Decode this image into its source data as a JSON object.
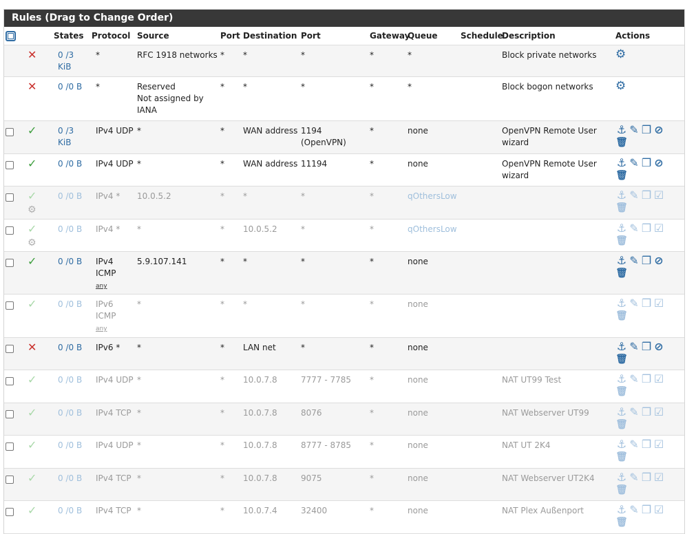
{
  "panel_title": "Rules (Drag to Change Order)",
  "columns": [
    "",
    "",
    "States",
    "Protocol",
    "Source",
    "Port",
    "Destination",
    "Port",
    "Gateway",
    "Queue",
    "Schedule",
    "Description",
    "Actions"
  ],
  "rows": [
    {
      "cb": false,
      "status": "block",
      "states": "0 /3 KiB",
      "protocol": "*",
      "protocol_sub": "",
      "source": "RFC 1918 networks",
      "sport": "*",
      "dest": "*",
      "dport": "*",
      "gateway": "*",
      "queue": "*",
      "schedule": "",
      "desc": "Block private networks",
      "actions": "gear",
      "disabled": false
    },
    {
      "cb": false,
      "status": "block",
      "states": "0 /0 B",
      "protocol": "*",
      "protocol_sub": "",
      "source": "Reserved\nNot assigned by IANA",
      "sport": "*",
      "dest": "*",
      "dport": "*",
      "gateway": "*",
      "queue": "*",
      "schedule": "",
      "desc": "Block bogon networks",
      "actions": "gear",
      "disabled": false
    },
    {
      "cb": true,
      "status": "pass",
      "states": "0 /3 KiB",
      "protocol": "IPv4 UDP",
      "protocol_sub": "",
      "source": "*",
      "sport": "*",
      "dest": "WAN address",
      "dport": "1194 (OpenVPN)",
      "gateway": "*",
      "queue": "none",
      "schedule": "",
      "desc": "OpenVPN Remote User wizard",
      "actions": "full",
      "disabled": false
    },
    {
      "cb": true,
      "status": "pass",
      "states": "0 /0 B",
      "protocol": "IPv4 UDP",
      "protocol_sub": "",
      "source": "*",
      "sport": "*",
      "dest": "WAN address",
      "dport": "11194",
      "gateway": "*",
      "queue": "none",
      "schedule": "",
      "desc": "OpenVPN Remote User wizard",
      "actions": "full",
      "disabled": false
    },
    {
      "cb": true,
      "status": "pass-gear",
      "states": "0 /0 B",
      "protocol": "IPv4 *",
      "protocol_sub": "",
      "source": "10.0.5.2",
      "sport": "*",
      "dest": "*",
      "dport": "*",
      "gateway": "*",
      "queue": "qOthersLow",
      "schedule": "",
      "desc": "",
      "actions": "full-enable",
      "disabled": true
    },
    {
      "cb": true,
      "status": "pass-gear",
      "states": "0 /0 B",
      "protocol": "IPv4 *",
      "protocol_sub": "",
      "source": "*",
      "sport": "*",
      "dest": "10.0.5.2",
      "dport": "*",
      "gateway": "*",
      "queue": "qOthersLow",
      "schedule": "",
      "desc": "",
      "actions": "full-enable",
      "disabled": true
    },
    {
      "cb": true,
      "status": "pass",
      "states": "0 /0 B",
      "protocol": "IPv4 ICMP",
      "protocol_sub": "any",
      "source": "5.9.107.141",
      "sport": "*",
      "dest": "*",
      "dport": "*",
      "gateway": "*",
      "queue": "none",
      "schedule": "",
      "desc": "",
      "actions": "full",
      "disabled": false
    },
    {
      "cb": true,
      "status": "pass",
      "states": "0 /0 B",
      "protocol": "IPv6 ICMP",
      "protocol_sub": "any",
      "source": "*",
      "sport": "*",
      "dest": "*",
      "dport": "*",
      "gateway": "*",
      "queue": "none",
      "schedule": "",
      "desc": "",
      "actions": "full-enable",
      "disabled": true
    },
    {
      "cb": true,
      "status": "block",
      "states": "0 /0 B",
      "protocol": "IPv6 *",
      "protocol_sub": "",
      "source": "*",
      "sport": "*",
      "dest": "LAN net",
      "dport": "*",
      "gateway": "*",
      "queue": "none",
      "schedule": "",
      "desc": "",
      "actions": "full",
      "disabled": false
    },
    {
      "cb": true,
      "status": "pass",
      "states": "0 /0 B",
      "protocol": "IPv4 UDP",
      "protocol_sub": "",
      "source": "*",
      "sport": "*",
      "dest": "10.0.7.8",
      "dport": "7777 - 7785",
      "gateway": "*",
      "queue": "none",
      "schedule": "",
      "desc": "NAT UT99 Test",
      "actions": "full-enable",
      "disabled": true
    },
    {
      "cb": true,
      "status": "pass",
      "states": "0 /0 B",
      "protocol": "IPv4 TCP",
      "protocol_sub": "",
      "source": "*",
      "sport": "*",
      "dest": "10.0.7.8",
      "dport": "8076",
      "gateway": "*",
      "queue": "none",
      "schedule": "",
      "desc": "NAT Webserver UT99",
      "actions": "full-enable",
      "disabled": true
    },
    {
      "cb": true,
      "status": "pass",
      "states": "0 /0 B",
      "protocol": "IPv4 UDP",
      "protocol_sub": "",
      "source": "*",
      "sport": "*",
      "dest": "10.0.7.8",
      "dport": "8777 - 8785",
      "gateway": "*",
      "queue": "none",
      "schedule": "",
      "desc": "NAT UT 2K4",
      "actions": "full-enable",
      "disabled": true
    },
    {
      "cb": true,
      "status": "pass",
      "states": "0 /0 B",
      "protocol": "IPv4 TCP",
      "protocol_sub": "",
      "source": "*",
      "sport": "*",
      "dest": "10.0.7.8",
      "dport": "9075",
      "gateway": "*",
      "queue": "none",
      "schedule": "",
      "desc": "NAT Webserver UT2K4",
      "actions": "full-enable",
      "disabled": true
    },
    {
      "cb": true,
      "status": "pass",
      "states": "0 /0 B",
      "protocol": "IPv4 TCP",
      "protocol_sub": "",
      "source": "*",
      "sport": "*",
      "dest": "10.0.7.4",
      "dport": "32400",
      "gateway": "*",
      "queue": "none",
      "schedule": "",
      "desc": "NAT Plex Außenport",
      "actions": "full-enable",
      "disabled": true
    }
  ],
  "row_heights": [
    46,
    64,
    48,
    47,
    48,
    47,
    62,
    63,
    47,
    48,
    47,
    48,
    47,
    48
  ]
}
